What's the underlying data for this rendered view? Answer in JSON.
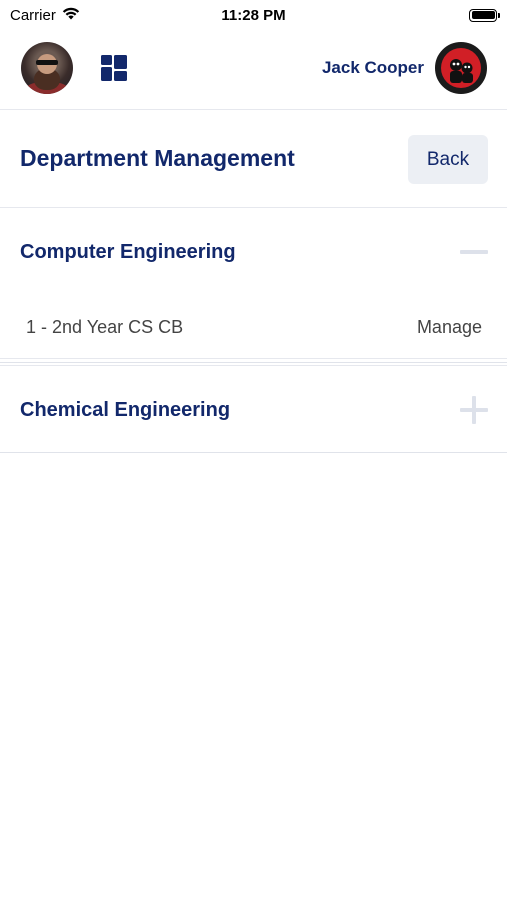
{
  "status_bar": {
    "carrier": "Carrier",
    "time": "11:28 PM"
  },
  "header": {
    "user_name": "Jack Cooper",
    "left_avatar_icon": "user-avatar",
    "grid_icon": "dashboard-grid-icon",
    "right_avatar_icon": "profile-avatar"
  },
  "page": {
    "title": "Department Management",
    "back_label": "Back"
  },
  "departments": [
    {
      "name": "Computer Engineering",
      "expanded": true,
      "toggle_icon": "minus-icon",
      "classes": [
        {
          "name": "1 - 2nd Year CS CB",
          "action": "Manage"
        }
      ]
    },
    {
      "name": "Chemical Engineering",
      "expanded": false,
      "toggle_icon": "plus-icon",
      "classes": []
    }
  ],
  "colors": {
    "primary": "#12286b",
    "back_button_bg": "#eceff4",
    "toggle_icon": "#dde1ea",
    "divider": "#e6e8ee"
  }
}
